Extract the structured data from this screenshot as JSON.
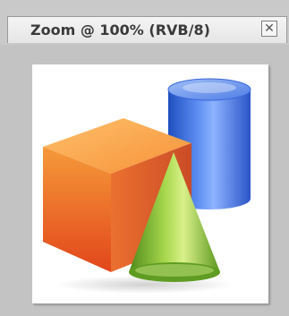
{
  "tab": {
    "title": "Zoom @ 100% (RVB/8)",
    "close_glyph": "✕"
  },
  "document": {
    "image_name": "3d-shapes-icon",
    "colors": {
      "cube": "#f0701e",
      "cylinder": "#3f73e0",
      "cone": "#8fc43a"
    }
  }
}
